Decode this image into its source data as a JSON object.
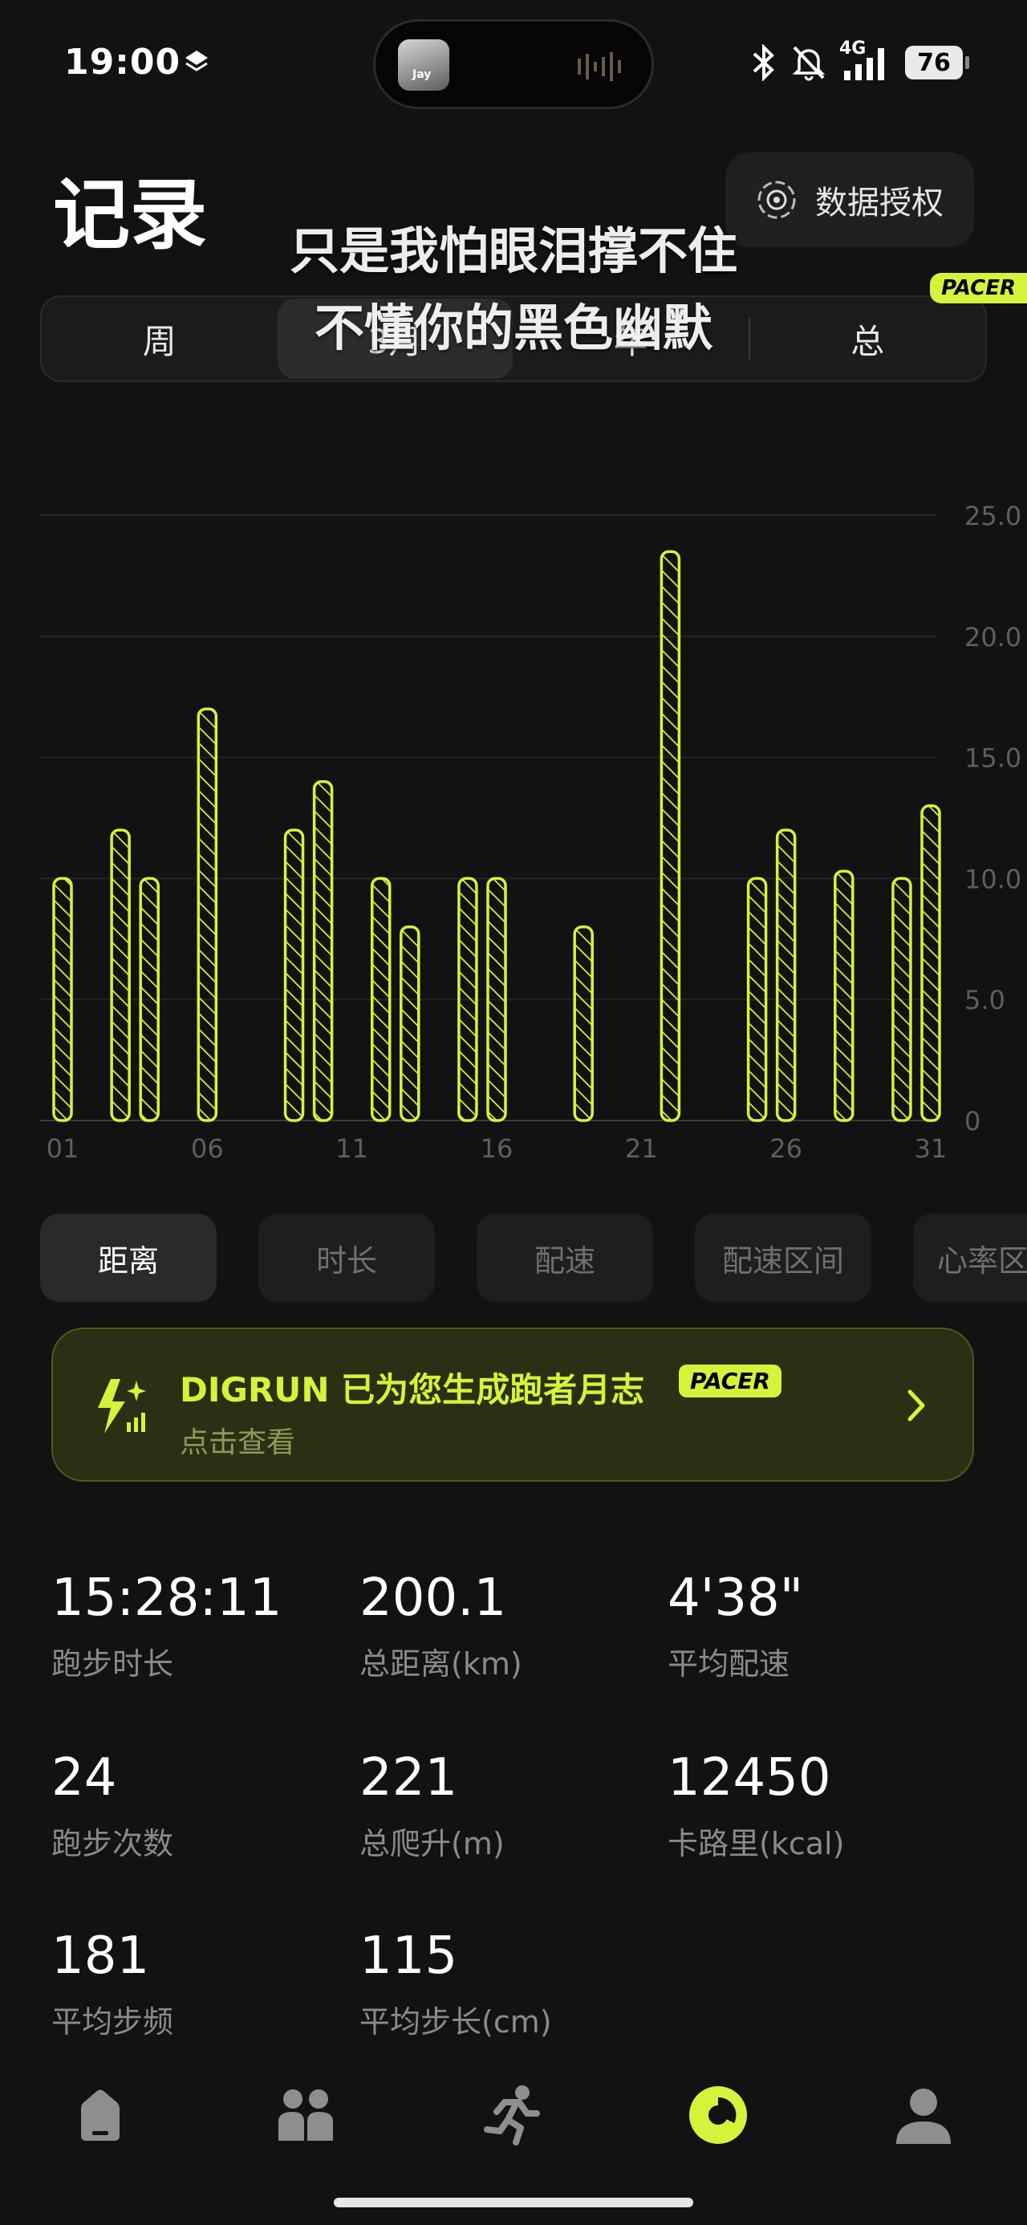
{
  "status_bar": {
    "time": "19:00",
    "network": "4G",
    "battery": "76",
    "now_playing_art_text": "Jay",
    "icons": [
      "layers-icon",
      "bluetooth-icon",
      "bell-off-icon",
      "signal-icon",
      "battery-icon"
    ]
  },
  "header": {
    "title": "记录",
    "auth_button": "数据授权"
  },
  "lyrics": {
    "line1": "只是我怕眼泪撑不住",
    "line2": "不懂你的黑色幽默"
  },
  "period_tabs": {
    "items": [
      "周",
      "3月",
      "年",
      "总"
    ],
    "active": "3月",
    "badge": "PACER"
  },
  "chart_data": {
    "type": "bar",
    "title": "",
    "xlabel": "",
    "ylabel": "",
    "x": [
      1,
      3,
      4,
      6,
      9,
      10,
      12,
      13,
      15,
      16,
      19,
      22,
      25,
      26,
      28,
      30,
      31
    ],
    "values": [
      10,
      12,
      10,
      17,
      12,
      14,
      10,
      8,
      10,
      10,
      8,
      23.5,
      10,
      12,
      10.3,
      10,
      13
    ],
    "xlim": [
      1,
      31
    ],
    "ylim": [
      0,
      25
    ],
    "yticks": [
      "0",
      "5.0",
      "10.0",
      "15.0",
      "20.0",
      "25.0"
    ],
    "xticks": [
      "01",
      "06",
      "11",
      "16",
      "21",
      "26",
      "31"
    ],
    "xtick_values": [
      1,
      6,
      11,
      16,
      21,
      26,
      31
    ],
    "grid": true,
    "bar_color": "#d6f23a",
    "bar_style": "hatched"
  },
  "metric_tabs": {
    "items": [
      "距离",
      "时长",
      "配速",
      "配速区间",
      "心率区间"
    ],
    "active": "距离"
  },
  "banner": {
    "title": "DIGRUN 已为您生成跑者月志",
    "badge": "PACER",
    "subtitle": "点击查看"
  },
  "stats": [
    {
      "value": "15:28:11",
      "label": "跑步时长"
    },
    {
      "value": "200.1",
      "label": "总距离(km)"
    },
    {
      "value": "4'38\"",
      "label": "平均配速"
    },
    {
      "value": "24",
      "label": "跑步次数"
    },
    {
      "value": "221",
      "label": "总爬升(m)"
    },
    {
      "value": "12450",
      "label": "卡路里(kcal)"
    },
    {
      "value": "181",
      "label": "平均步频"
    },
    {
      "value": "115",
      "label": "平均步长(cm)"
    }
  ],
  "bottom_nav": {
    "items": [
      "home-icon",
      "friends-icon",
      "running-icon",
      "stats-icon",
      "profile-icon"
    ],
    "active": "stats-icon",
    "accent": "#d6f23a"
  }
}
